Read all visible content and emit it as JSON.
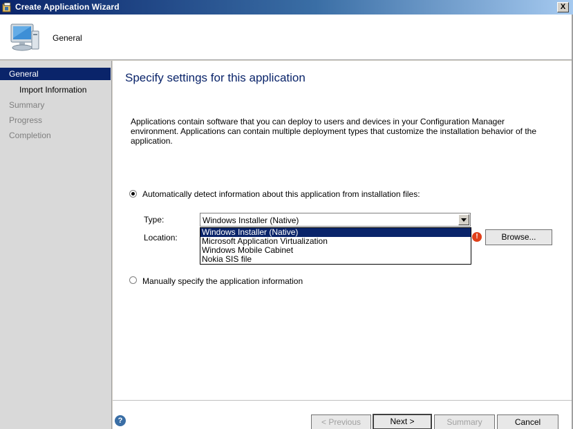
{
  "window": {
    "title": "Create Application Wizard",
    "close_label": "X"
  },
  "header": {
    "title": "General",
    "icon": "computer-icon"
  },
  "nav": {
    "items": [
      {
        "label": "General"
      },
      {
        "label": "Import Information"
      },
      {
        "label": "Summary"
      },
      {
        "label": "Progress"
      },
      {
        "label": "Completion"
      }
    ]
  },
  "main": {
    "title": "Specify settings for this application",
    "description": "Applications contain software that you can deploy to users and devices in your Configuration Manager environment. Applications can contain multiple deployment types that customize the installation behavior of the application.",
    "auto_detect_label": "Automatically detect information about this application from installation files:",
    "type_label": "Type:",
    "type_value": "Windows Installer (Native)",
    "type_options": [
      "Windows Installer (Native)",
      "Microsoft Application Virtualization",
      "Windows Mobile Cabinet",
      "Nokia SIS file"
    ],
    "location_label": "Location:",
    "browse_label": "Browse...",
    "manual_label": "Manually specify the application information"
  },
  "footer": {
    "previous_label": "< Previous",
    "next_label": "Next >",
    "summary_label": "Summary",
    "cancel_label": "Cancel"
  },
  "colors": {
    "accent": "#0a246a",
    "error": "#e0401a"
  }
}
